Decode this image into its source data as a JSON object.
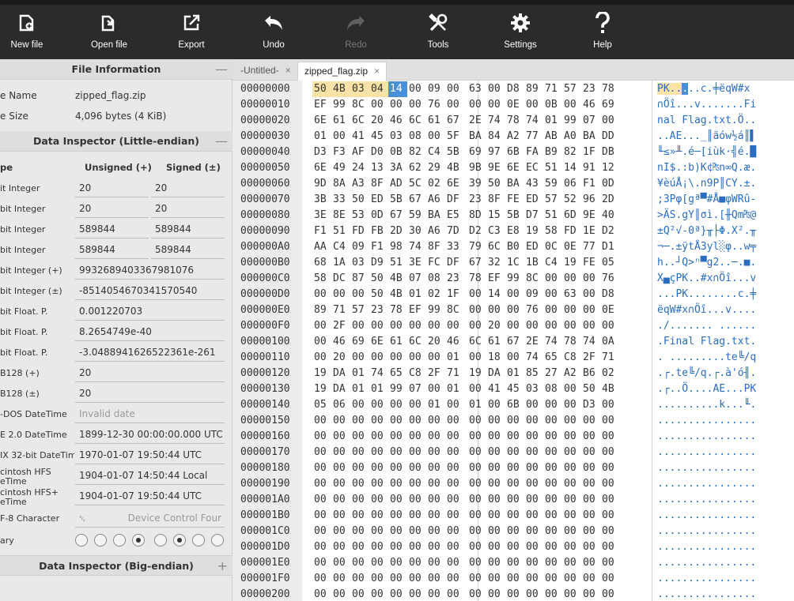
{
  "toolbar": {
    "buttons": [
      {
        "label": "New file",
        "icon": "new-file-icon"
      },
      {
        "label": "Open file",
        "icon": "open-file-icon"
      },
      {
        "label": "Export",
        "icon": "export-icon"
      },
      {
        "label": "Undo",
        "icon": "undo-icon"
      },
      {
        "label": "Redo",
        "icon": "redo-icon",
        "disabled": true
      },
      {
        "label": "Tools",
        "icon": "tools-icon"
      },
      {
        "label": "Settings",
        "icon": "gear-icon"
      },
      {
        "label": "Help",
        "icon": "help-icon"
      }
    ]
  },
  "file_info": {
    "title": "File Information",
    "collapse": "—",
    "name_label": "e Name",
    "name_value": "zipped_flag.zip",
    "size_label": "e Size",
    "size_value": "4,096 bytes (4 KiB)"
  },
  "inspector_le": {
    "title": "Data Inspector (Little-endian)",
    "collapse": "—",
    "col_type": "pe",
    "col_unsigned": "Unsigned (+)",
    "col_signed": "Signed (±)",
    "rows": [
      {
        "name": "it Integer",
        "u": "20",
        "s": "20"
      },
      {
        "name": "bit Integer",
        "u": "20",
        "s": "20"
      },
      {
        "name": "bit Integer",
        "u": "589844",
        "s": "589844"
      },
      {
        "name": "bit Integer",
        "u": "589844",
        "s": "589844"
      },
      {
        "name": "bit Integer (+)",
        "w": "9932689403367981076"
      },
      {
        "name": "bit Integer (±)",
        "w": "-8514054670341570540"
      },
      {
        "name": "bit Float. P.",
        "w": "0.001220703"
      },
      {
        "name": "bit Float. P.",
        "w": "8.2654749e-40"
      },
      {
        "name": "bit Float. P.",
        "w": "-3.0488941626522361e-261"
      },
      {
        "name": "B128 (+)",
        "w": "20"
      },
      {
        "name": "B128 (±)",
        "w": "20"
      },
      {
        "name": "-DOS DateTime",
        "w": "Invalid date",
        "muted": true
      },
      {
        "name": "E 2.0 DateTime",
        "w": "1899-12-30 00:00:00.000 UTC"
      },
      {
        "name": "IX 32-bit DateTime",
        "w": "1970-01-07 19:50:44 UTC"
      },
      {
        "name": "cintosh HFS\neTime",
        "w": "1904-01-07 14:50:44 Local"
      },
      {
        "name": "cintosh HFS+\neTime",
        "w": "1904-01-07 19:50:44 UTC"
      }
    ],
    "utf8_label": "F-8 Character",
    "utf8_glyph": "␔",
    "utf8_value": "Device Control Four",
    "binary_label": "ary",
    "binary_bits": [
      0,
      0,
      0,
      1,
      0,
      1,
      0,
      0
    ]
  },
  "inspector_be": {
    "title": "Data Inspector (Big-endian)",
    "expand": "+"
  },
  "tabs": [
    {
      "label": "-Untitled-",
      "close": "×"
    },
    {
      "label": "zipped_flag.zip",
      "close": "×",
      "active": true
    }
  ],
  "hex": {
    "rows": [
      {
        "off": "00000000",
        "bytes": "50 4B 03 04 14 00 09 00 63 00 D8 89 71 57 23 78",
        "ascii": "PK....c.╪ëqW#x"
      },
      {
        "off": "00000010",
        "bytes": "EF 99 8C 00 00 00 76 00 00 00 0E 00 0B 00 46 69",
        "ascii": "∩Öî...v.......Fi"
      },
      {
        "off": "00000020",
        "bytes": "6E 61 6C 20 46 6C 61 67 2E 74 78 74 01 99 07 00",
        "ascii": "nal Flag.txt.Ö.."
      },
      {
        "off": "00000030",
        "bytes": "01 00 41 45 03 08 00 5F BA 84 A2 77 AB A0 BA DD",
        "ascii": "..AE..._║äów½á║▌"
      },
      {
        "off": "00000040",
        "bytes": "D3 F3 AF D0 0B 82 C4 5B 69 97 6B FA B9 82 1F DB",
        "ascii": "╙≤»╨.é─[iùk·╣é.█"
      },
      {
        "off": "00000050",
        "bytes": "6E 49 24 13 3A 62 29 4B 9B 9E 6E EC 51 14 91 12",
        "ascii": "nI$.:b)K¢₧n∞Q.æ."
      },
      {
        "off": "00000060",
        "bytes": "9D 8A A3 8F AD 5C 02 6E 39 50 BA 43 59 06 F1 0D",
        "ascii": "¥èúÅ¡\\.n9P║CY.±."
      },
      {
        "off": "00000070",
        "bytes": "3B 33 50 ED 5B 67 A6 DF 23 8F FE ED 57 52 96 2D",
        "ascii": ";3Pφ[gª▀#Å■φWRû-"
      },
      {
        "off": "00000080",
        "bytes": "3E 8E 53 0D 67 59 BA E5 8D 15 5B D7 51 6D 9E 40",
        "ascii": ">ÄS.gY║σì.[╫Qm₧@"
      },
      {
        "off": "00000090",
        "bytes": "F1 51 FD FB 2D 30 A6 7D D2 C3 E8 19 58 FD 1E D2",
        "ascii": "±Q²√-0ª}╥├Φ.X².╥"
      },
      {
        "off": "000000A0",
        "bytes": "AA C4 09 F1 98 74 8F 33 79 6C B0 ED 0C 0E 77 D1",
        "ascii": "¬─.±ÿtÅ3yl░φ..w╤"
      },
      {
        "off": "000000B0",
        "bytes": "68 1A 03 D9 51 3E FC DF 67 32 1C 1B C4 19 FE 05",
        "ascii": "h..┘Q>ⁿ▀g2..─.■."
      },
      {
        "off": "000000C0",
        "bytes": "58 DC 87 50 4B 07 08 23 78 EF 99 8C 00 00 00 76",
        "ascii": "X▄çPK..#x∩Öî...v"
      },
      {
        "off": "000000D0",
        "bytes": "00 00 00 50 4B 01 02 1F 00 14 00 09 00 63 00 D8",
        "ascii": "...PK........c.╪"
      },
      {
        "off": "000000E0",
        "bytes": "89 71 57 23 78 EF 99 8C 00 00 00 76 00 00 00 0E",
        "ascii": "ëqW#x∩Öî...v...."
      },
      {
        "off": "000000F0",
        "bytes": "00 2F 00 00 00 00 00 00 00 20 00 00 00 00 00 00",
        "ascii": "./....... ......"
      },
      {
        "off": "00000100",
        "bytes": "00 46 69 6E 61 6C 20 46 6C 61 67 2E 74 78 74 0A",
        "ascii": ".Final Flag.txt."
      },
      {
        "off": "00000110",
        "bytes": "00 20 00 00 00 00 00 01 00 18 00 74 65 C8 2F 71",
        "ascii": ". .........te╚/q"
      },
      {
        "off": "00000120",
        "bytes": "19 DA 01 74 65 C8 2F 71 19 DA 01 85 27 A2 B6 02",
        "ascii": ".┌.te╚/q.┌.à'ó╢."
      },
      {
        "off": "00000130",
        "bytes": "19 DA 01 01 99 07 00 01 00 41 45 03 08 00 50 4B",
        "ascii": ".┌..Ö....AE...PK"
      },
      {
        "off": "00000140",
        "bytes": "05 06 00 00 00 00 01 00 01 00 6B 00 00 00 D3 00",
        "ascii": "..........k...╙."
      },
      {
        "off": "00000150",
        "bytes": "00 00 00 00 00 00 00 00 00 00 00 00 00 00 00 00",
        "ascii": "................"
      },
      {
        "off": "00000160",
        "bytes": "00 00 00 00 00 00 00 00 00 00 00 00 00 00 00 00",
        "ascii": "................"
      },
      {
        "off": "00000170",
        "bytes": "00 00 00 00 00 00 00 00 00 00 00 00 00 00 00 00",
        "ascii": "................"
      },
      {
        "off": "00000180",
        "bytes": "00 00 00 00 00 00 00 00 00 00 00 00 00 00 00 00",
        "ascii": "................"
      },
      {
        "off": "00000190",
        "bytes": "00 00 00 00 00 00 00 00 00 00 00 00 00 00 00 00",
        "ascii": "................"
      },
      {
        "off": "000001A0",
        "bytes": "00 00 00 00 00 00 00 00 00 00 00 00 00 00 00 00",
        "ascii": "................"
      },
      {
        "off": "000001B0",
        "bytes": "00 00 00 00 00 00 00 00 00 00 00 00 00 00 00 00",
        "ascii": "................"
      },
      {
        "off": "000001C0",
        "bytes": "00 00 00 00 00 00 00 00 00 00 00 00 00 00 00 00",
        "ascii": "................"
      },
      {
        "off": "000001D0",
        "bytes": "00 00 00 00 00 00 00 00 00 00 00 00 00 00 00 00",
        "ascii": "................"
      },
      {
        "off": "000001E0",
        "bytes": "00 00 00 00 00 00 00 00 00 00 00 00 00 00 00 00",
        "ascii": "................"
      },
      {
        "off": "000001F0",
        "bytes": "00 00 00 00 00 00 00 00 00 00 00 00 00 00 00 00",
        "ascii": "................"
      },
      {
        "off": "00000200",
        "bytes": "00 00 00 00 00 00 00 00 00 00 00 00 00 00 00 00",
        "ascii": "................"
      }
    ]
  }
}
